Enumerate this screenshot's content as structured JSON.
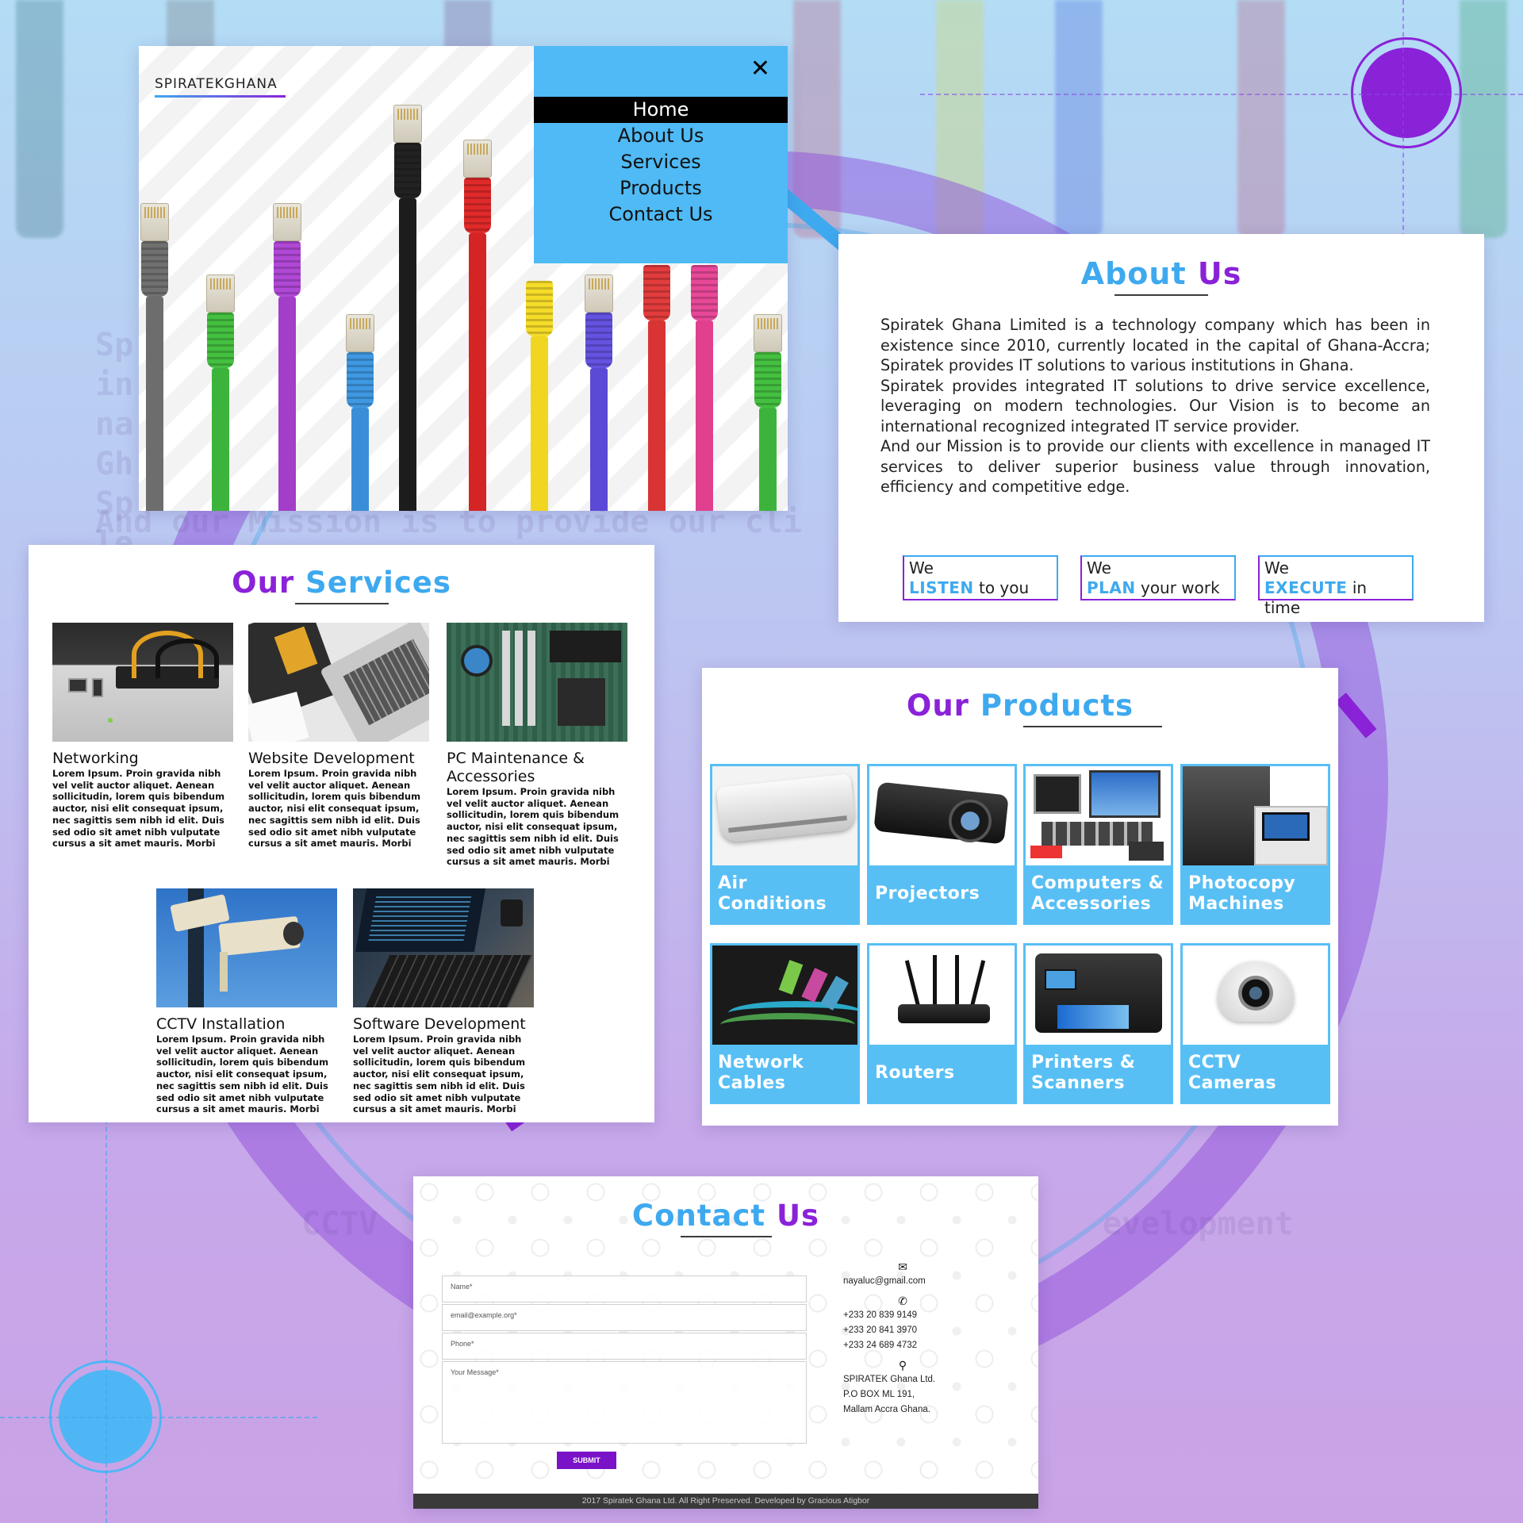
{
  "hero": {
    "logo": "SPIRATEKGHANA",
    "menu": [
      "Home",
      "About Us",
      "Services",
      "Products",
      "Contact Us"
    ],
    "close_icon": "close-icon"
  },
  "about": {
    "title_part1": "About ",
    "title_part2": "Us",
    "paragraphs": [
      "Spiratek Ghana Limited is a technology company which has been in existence since 2010, currently located in the capital of Ghana-Accra; Spiratek provides IT solutions to various institutions in Ghana.",
      "Spiratek provides integrated IT solutions to drive service excellence, leveraging on modern technologies. Our Vision is to become an international recognized integrated IT service provider.",
      "And our Mission is to provide our clients with excellence in managed IT services to deliver superior business value through innovation, efficiency and competitive edge."
    ],
    "mottos": [
      {
        "we": "We",
        "key": "LISTEN",
        "rest": " to you"
      },
      {
        "we": "We",
        "key": "PLAN",
        "rest": " your work"
      },
      {
        "we": "We",
        "key": "EXECUTE",
        "rest": " in time"
      }
    ]
  },
  "services": {
    "title_part1": "Our ",
    "title_part2": "Services",
    "items": [
      {
        "name": "Networking",
        "desc": "Lorem Ipsum. Proin gravida nibh vel velit auctor aliquet. Aenean sollicitudin, lorem quis bibendum auctor, nisi elit consequat ipsum, nec sagittis sem nibh id elit. Duis sed odio sit amet nibh vulputate cursus a sit amet mauris. Morbi"
      },
      {
        "name": "Website Development",
        "desc": "Lorem Ipsum. Proin gravida nibh vel velit auctor aliquet. Aenean sollicitudin, lorem quis bibendum auctor, nisi elit consequat ipsum, nec sagittis sem nibh id elit. Duis sed odio sit amet nibh vulputate cursus a sit amet mauris. Morbi"
      },
      {
        "name": "PC Maintenance & Accessories",
        "desc": "Lorem Ipsum. Proin gravida nibh vel velit auctor aliquet. Aenean sollicitudin, lorem quis bibendum auctor, nisi elit consequat ipsum, nec sagittis sem nibh id elit. Duis sed odio sit amet nibh vulputate cursus a sit amet mauris. Morbi"
      },
      {
        "name": "CCTV Installation",
        "desc": "Lorem Ipsum. Proin gravida nibh vel velit auctor aliquet. Aenean sollicitudin, lorem quis bibendum auctor, nisi elit consequat ipsum, nec sagittis sem nibh id elit. Duis sed odio sit amet nibh vulputate cursus a sit amet mauris. Morbi"
      },
      {
        "name": "Software Development",
        "desc": "Lorem Ipsum. Proin gravida nibh vel velit auctor aliquet. Aenean sollicitudin, lorem quis bibendum auctor, nisi elit consequat ipsum, nec sagittis sem nibh id elit. Duis sed odio sit amet nibh vulputate cursus a sit amet mauris. Morbi"
      }
    ]
  },
  "products": {
    "title_part1": "Our ",
    "title_part2": "Products",
    "items": [
      "Air Conditions",
      "Projectors",
      "Computers & Accessories",
      "Photocopy Machines",
      "Network Cables",
      "Routers",
      "Printers & Scanners",
      "CCTV Cameras"
    ]
  },
  "contact": {
    "title_part1": "Contact ",
    "title_part2": "Us",
    "placeholders": {
      "name": "Name*",
      "email": "email@example.org*",
      "phone": "Phone*",
      "message": "Your Message*"
    },
    "submit": "SUBMIT",
    "email": "nayaluc@gmail.com",
    "phones": [
      "+233 20 839 9149",
      "+233 20 841 3970",
      "+233 24 689 4732"
    ],
    "address": [
      "SPIRATEK Ghana Ltd.",
      "P.O BOX ML 191,",
      "Mallam Accra Ghana."
    ],
    "footer": "2017 Spiratek Ghana Ltd.  All Right Preserved. Developed by Gracious Atigbor"
  },
  "colors": {
    "blue": "#3ea9ef",
    "purple": "#8a22d8",
    "menu_bg": "#4fbaf5",
    "product_label": "#58bff5"
  }
}
